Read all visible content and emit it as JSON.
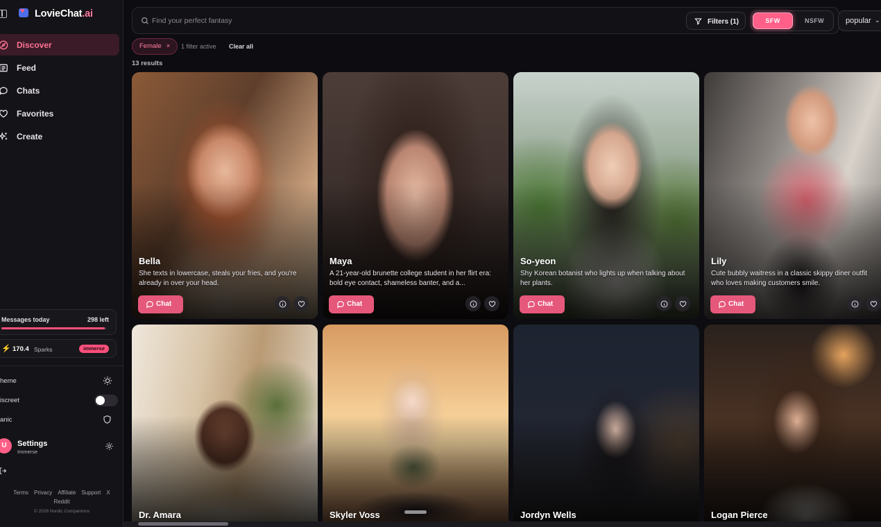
{
  "brand": {
    "name": "LovieChat",
    "suffix": ".ai"
  },
  "nav": [
    {
      "label": "Discover",
      "icon": "compass-icon"
    },
    {
      "label": "Feed",
      "icon": "newspaper-icon"
    },
    {
      "label": "Chats",
      "icon": "chat-bubble-icon"
    },
    {
      "label": "Favorites",
      "icon": "heart-icon"
    },
    {
      "label": "Create",
      "icon": "sparkles-icon"
    }
  ],
  "quota": {
    "label": "Messages today",
    "left": "298 left",
    "fraction": 0.99
  },
  "sparks": {
    "value": "170.4",
    "label": "Sparks",
    "badge": "immerse"
  },
  "settings_rows": {
    "theme": "heme",
    "discreet": "iscreet",
    "panic": "anic"
  },
  "profile": {
    "initial": "U",
    "name": "Settings",
    "tier": "Immerse"
  },
  "footer": {
    "links": [
      "Terms",
      "Privacy",
      "Affiliate",
      "Support",
      "X",
      "Reddit"
    ],
    "copyright": "© 2026 Nordic Companions"
  },
  "search": {
    "placeholder": "Find your perfect fantasy"
  },
  "filters": {
    "label": "Filters (1)"
  },
  "mode": {
    "sfw": "SFW",
    "nsfw": "NSFW"
  },
  "sort": {
    "value": "popular"
  },
  "chip": {
    "label": "Female"
  },
  "filter_status": {
    "active": "1 filter active",
    "clear": "Clear all"
  },
  "results": "13 results",
  "cards": [
    {
      "name": "Bella",
      "desc": "She texts in lowercase, steals your fries, and you're already in over your head.",
      "chat": "Chat"
    },
    {
      "name": "Maya",
      "desc": "A 21-year-old brunette college student in her flirt era: bold eye contact, shameless banter, and a...",
      "chat": "Chat"
    },
    {
      "name": "So-yeon",
      "desc": "Shy Korean botanist who lights up when talking about her plants.",
      "chat": "Chat"
    },
    {
      "name": "Lily",
      "desc": "Cute bubbly waitress in a classic skippy diner outfit who loves making customers smile.",
      "chat": "Chat"
    },
    {
      "name": "Dr. Amara"
    },
    {
      "name": "Skyler Voss"
    },
    {
      "name": "Jordyn Wells"
    },
    {
      "name": "Logan Pierce"
    }
  ],
  "colors": {
    "accent": "#ff5f88",
    "background": "#0d0c10",
    "sidebar": "#141317"
  }
}
